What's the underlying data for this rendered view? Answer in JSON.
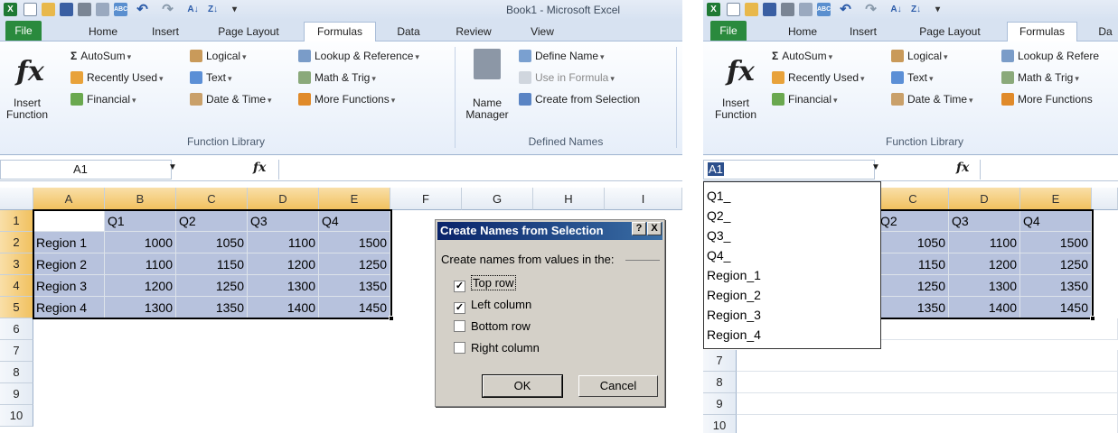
{
  "window": {
    "title": "Book1 - Microsoft Excel"
  },
  "qat_icons": [
    "excel-logo-icon",
    "new-file-icon",
    "open-file-icon",
    "save-icon",
    "print-icon",
    "print-preview-icon",
    "spelling-icon",
    "undo-icon",
    "redo-icon",
    "sort-ascending-icon",
    "sort-descending-icon",
    "customize-qat-icon"
  ],
  "tabs": [
    "File",
    "Home",
    "Insert",
    "Page Layout",
    "Formulas",
    "Data",
    "Review",
    "View"
  ],
  "right_tabs": [
    "File",
    "Home",
    "Insert",
    "Page Layout",
    "Formulas",
    "Da"
  ],
  "ribbon": {
    "insert_function_line1": "Insert",
    "insert_function_line2": "Function",
    "autosum": "AutoSum",
    "recently_used": "Recently Used",
    "financial": "Financial",
    "logical": "Logical",
    "text": "Text",
    "date_time": "Date & Time",
    "lookup": "Lookup & Reference",
    "lookup_cut": "Lookup & Refere",
    "math": "Math & Trig",
    "more_functions": "More Functions",
    "function_library": "Function Library",
    "name_manager_line1": "Name",
    "name_manager_line2": "Manager",
    "define_name": "Define Name",
    "use_in_formula": "Use in Formula",
    "create_from_selection": "Create from Selection",
    "defined_names": "Defined Names"
  },
  "formula_bar": {
    "name_box": "A1",
    "fx": "fx"
  },
  "columns": [
    "A",
    "B",
    "C",
    "D",
    "E",
    "F",
    "G",
    "H",
    "I"
  ],
  "rows": [
    "1",
    "2",
    "3",
    "4",
    "5",
    "6",
    "7",
    "8",
    "9",
    "10"
  ],
  "right_columns": [
    "C",
    "D",
    "E"
  ],
  "right_rows": [
    "7",
    "8",
    "9",
    "10"
  ],
  "table": {
    "header": [
      "",
      "Q1",
      "Q2",
      "Q3",
      "Q4"
    ],
    "rows": [
      [
        "Region 1",
        "1000",
        "1050",
        "1100",
        "1500"
      ],
      [
        "Region 2",
        "1100",
        "1150",
        "1200",
        "1250"
      ],
      [
        "Region 3",
        "1200",
        "1250",
        "1300",
        "1350"
      ],
      [
        "Region 4",
        "1300",
        "1350",
        "1400",
        "1450"
      ]
    ],
    "q2_cut": "Q2"
  },
  "dialog": {
    "title": "Create Names from Selection",
    "help": "?",
    "close": "X",
    "group_label": "Create names from values in the:",
    "options": [
      {
        "label": "Top row",
        "checked": true
      },
      {
        "label": "Left column",
        "checked": true
      },
      {
        "label": "Bottom row",
        "checked": false
      },
      {
        "label": "Right column",
        "checked": false
      }
    ],
    "ok": "OK",
    "cancel": "Cancel"
  },
  "name_list": [
    "Q1_",
    "Q2_",
    "Q3_",
    "Q4_",
    "Region_1",
    "Region_2",
    "Region_3",
    "Region_4"
  ],
  "colors": {
    "selection_fill": "#b7c2dd",
    "file_tab": "#2a8a3d",
    "dialog_title": "#0a246a"
  }
}
